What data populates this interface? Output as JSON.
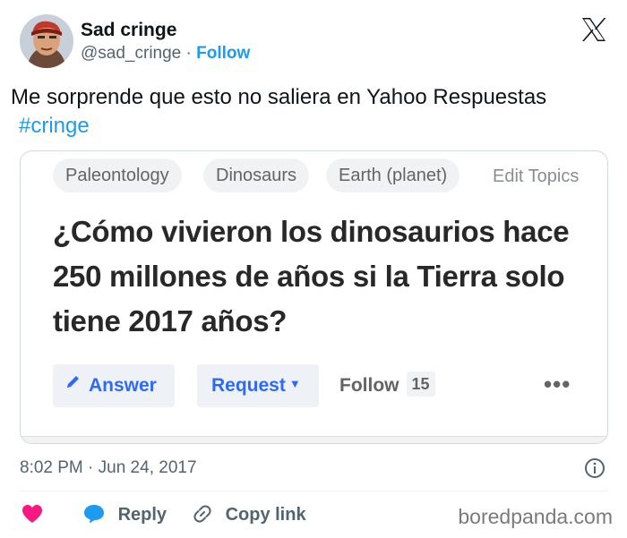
{
  "tweet": {
    "author_name": "Sad cringe",
    "handle": "@sad_cringe",
    "separator": "·",
    "follow_label": "Follow",
    "text": "Me sorprende que esto no saliera en Yahoo Respuestas",
    "hashtag": "#cringe",
    "timestamp": "8:02 PM · Jun 24, 2017",
    "reply_label": "Reply",
    "copy_link_label": "Copy link",
    "watermark": "boredpanda.com"
  },
  "quora": {
    "topics": [
      "Paleontology",
      "Dinosaurs",
      "Earth (planet)"
    ],
    "edit_topics_label": "Edit Topics",
    "question": "¿Cómo vivieron los dinosaurios hace 250 millones de años si la Tierra solo tiene 2017 años?",
    "answer_label": "Answer",
    "request_label": "Request",
    "follow_label": "Follow",
    "follow_count": "15",
    "more_label": "•••"
  },
  "colors": {
    "link_blue": "#1d9bf0",
    "quora_blue": "#2e69ff",
    "like_pink": "#f91880",
    "muted_gray": "#536471"
  },
  "icons": {
    "avatar": "avatar-photo",
    "platform": "x-logo-icon",
    "info": "info-icon",
    "like": "heart-icon",
    "reply": "reply-bubble-icon",
    "copy_link": "link-icon",
    "answer": "pencil-icon",
    "request": "caret-down-icon"
  }
}
